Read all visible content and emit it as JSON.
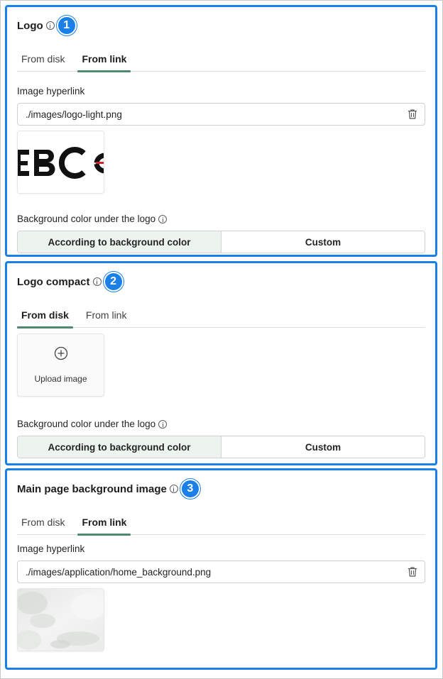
{
  "sections": [
    {
      "title": "Logo",
      "badge": "1",
      "tabs": [
        {
          "label": "From disk",
          "active": false
        },
        {
          "label": "From link",
          "active": true
        }
      ],
      "hyperlink_label": "Image hyperlink",
      "hyperlink_value": "./images/logo-light.png",
      "preview_text": "EBC",
      "bg_label": "Background color under the logo",
      "bg_options": [
        {
          "label": "According to background color",
          "selected": true
        },
        {
          "label": "Custom",
          "selected": false
        }
      ]
    },
    {
      "title": "Logo compact",
      "badge": "2",
      "tabs": [
        {
          "label": "From disk",
          "active": true
        },
        {
          "label": "From link",
          "active": false
        }
      ],
      "upload_label": "Upload image",
      "bg_label": "Background color under the logo",
      "bg_options": [
        {
          "label": "According to background color",
          "selected": true
        },
        {
          "label": "Custom",
          "selected": false
        }
      ]
    },
    {
      "title": "Main page background image",
      "badge": "3",
      "tabs": [
        {
          "label": "From disk",
          "active": false
        },
        {
          "label": "From link",
          "active": true
        }
      ],
      "hyperlink_label": "Image hyperlink",
      "hyperlink_value": "./images/application/home_background.png"
    }
  ],
  "colors": {
    "highlight_border": "#1a7fe6",
    "tab_indicator": "#4e8a6e",
    "selected_segment": "#edf4f0"
  },
  "icons": [
    "info-icon",
    "trash-icon",
    "add-circle-icon"
  ]
}
